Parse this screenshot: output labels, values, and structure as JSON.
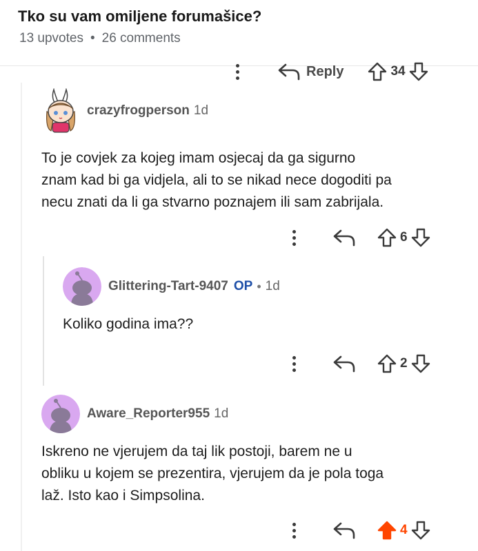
{
  "post": {
    "title": "Tko su vam omiljene forumašice?",
    "upvotes": "13 upvotes",
    "separator": "•",
    "comments": "26 comments"
  },
  "top_actions": {
    "reply_label": "Reply",
    "score": "34"
  },
  "comments": [
    {
      "username": "crazyfrogperson",
      "time": "1d",
      "avatar": "bunny-girl-avatar",
      "text_lines": [
        "To je covjek za kojeg imam osjecaj da ga sigurno",
        "znam kad bi ga vidjela, ali to se nikad nece dogoditi pa",
        "necu znati da li ga stvarno poznajem ili sam zabrijala."
      ],
      "score": "6"
    },
    {
      "username": "Glittering-Tart-9407",
      "op_badge": "OP",
      "separator": "•",
      "time": "1d",
      "avatar": "default-snoo-avatar",
      "text_lines": [
        "Koliko godina ima??"
      ],
      "score": "2"
    },
    {
      "username": "Aware_Reporter955",
      "time": "1d",
      "avatar": "default-snoo-avatar",
      "text_lines": [
        "Iskreno ne vjerujem da taj lik postoji, barem ne u",
        "obliku u kojem se prezentira, vjerujem da je pola toga",
        "laž. Isto kao i Simpsolina."
      ],
      "score": "4",
      "upvoted": true
    }
  ],
  "colors": {
    "upvote_active": "#ff4500",
    "op_badge": "#1e4fa8",
    "avatar_bg": "#d9a8f0",
    "snoo_body": "#8a7a98"
  }
}
